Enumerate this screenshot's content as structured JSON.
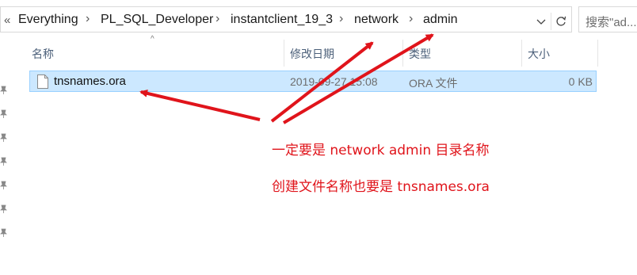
{
  "address_bar": {
    "overflow_icon": "double-chevron-left-icon",
    "crumbs": [
      "Everything",
      "PL_SQL_Developer",
      "instantclient_19_3",
      "network",
      "admin"
    ],
    "separator_icon": "chevron-right-icon",
    "dropdown_icon": "chevron-down-icon",
    "refresh_icon": "refresh-icon"
  },
  "search": {
    "placeholder": "搜索\"ad..."
  },
  "columns": {
    "name": "名称",
    "modified": "修改日期",
    "type": "类型",
    "size": "大小"
  },
  "files": [
    {
      "name": "tnsnames.ora",
      "modified": "2019-09-27 15:08",
      "type": "ORA 文件",
      "size": "0 KB",
      "selected": true
    }
  ],
  "annotations": {
    "line1": "一定要是 network admin 目录名称",
    "line2": "创建文件名称也要是 tnsnames.ora",
    "color": "#e0141b"
  },
  "colors": {
    "selection_bg": "#cce8ff",
    "selection_border": "#99d1ff",
    "header_text": "#4c607a"
  }
}
